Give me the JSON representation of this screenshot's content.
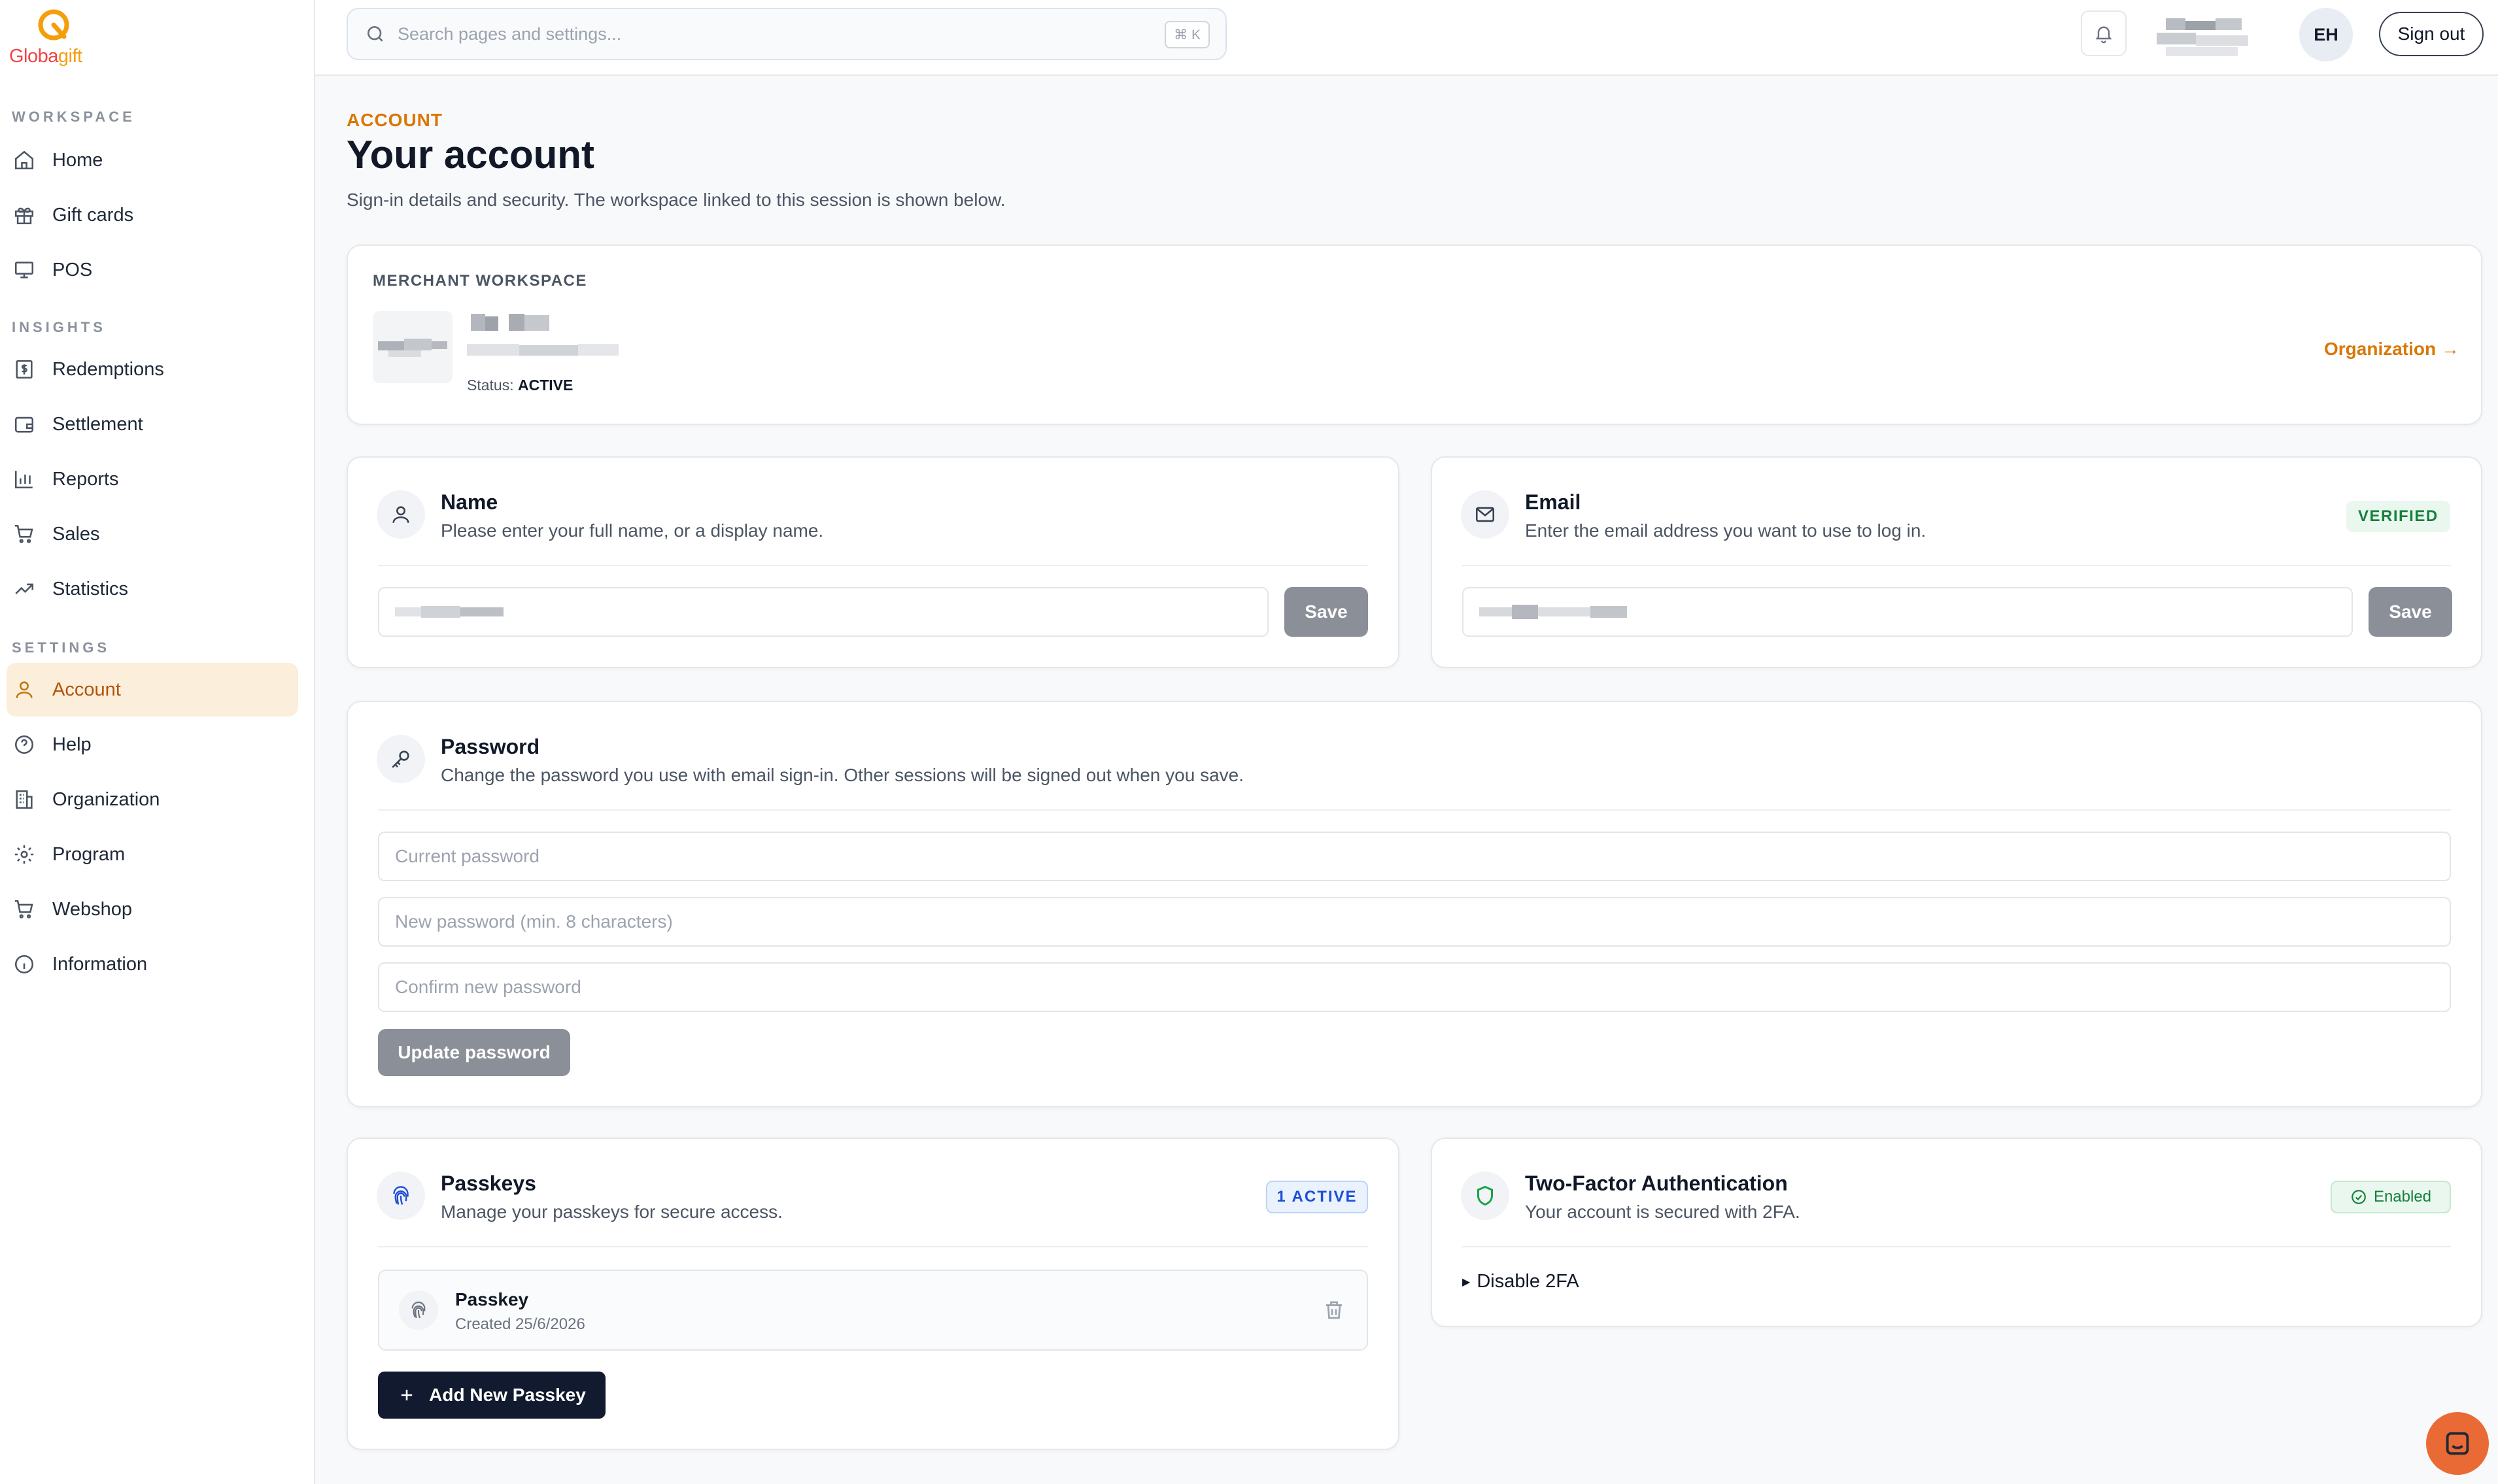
{
  "app": {
    "name_part1": "Globa",
    "name_part2": "gift",
    "brand_color": "#d97706"
  },
  "sidebar": {
    "sections": [
      {
        "title": "WORKSPACE",
        "items": [
          {
            "label": "Home",
            "icon": "home-icon"
          },
          {
            "label": "Gift cards",
            "icon": "gift-icon"
          },
          {
            "label": "POS",
            "icon": "monitor-icon"
          }
        ]
      },
      {
        "title": "INSIGHTS",
        "items": [
          {
            "label": "Redemptions",
            "icon": "receipt-icon"
          },
          {
            "label": "Settlement",
            "icon": "wallet-icon"
          },
          {
            "label": "Reports",
            "icon": "bar-chart-icon"
          },
          {
            "label": "Sales",
            "icon": "cart-icon"
          },
          {
            "label": "Statistics",
            "icon": "trend-icon"
          }
        ]
      },
      {
        "title": "SETTINGS",
        "items": [
          {
            "label": "Account",
            "icon": "user-icon",
            "active": true
          },
          {
            "label": "Help",
            "icon": "help-icon"
          },
          {
            "label": "Organization",
            "icon": "building-icon"
          },
          {
            "label": "Program",
            "icon": "gear-icon"
          },
          {
            "label": "Webshop",
            "icon": "cart-icon"
          },
          {
            "label": "Information",
            "icon": "info-icon"
          }
        ]
      }
    ]
  },
  "header": {
    "search_placeholder": "Search pages and settings...",
    "shortcut": "⌘ K",
    "avatar_initials": "EH",
    "sign_out": "Sign out"
  },
  "page": {
    "eyebrow": "ACCOUNT",
    "title": "Your account",
    "subtitle": "Sign-in details and security. The workspace linked to this session is shown below."
  },
  "merchant": {
    "label": "MERCHANT WORKSPACE",
    "status_label": "Status:",
    "status_value": "ACTIVE",
    "org_link": "Organization →"
  },
  "name_card": {
    "title": "Name",
    "description": "Please enter your full name, or a display name.",
    "save": "Save"
  },
  "email_card": {
    "title": "Email",
    "description": "Enter the email address you want to use to log in.",
    "badge": "VERIFIED",
    "save": "Save"
  },
  "password_card": {
    "title": "Password",
    "description": "Change the password you use with email sign-in. Other sessions will be signed out when you save.",
    "current_placeholder": "Current password",
    "new_placeholder": "New password (min. 8 characters)",
    "confirm_placeholder": "Confirm new password",
    "button": "Update password"
  },
  "passkeys_card": {
    "title": "Passkeys",
    "description": "Manage your passkeys for secure access.",
    "badge": "1 ACTIVE",
    "passkey_name": "Passkey",
    "passkey_created": "Created 25/6/2026",
    "add_button": "Add New Passkey"
  },
  "twofa_card": {
    "title": "Two-Factor Authentication",
    "description": "Your account is secured with 2FA.",
    "badge": "Enabled",
    "disable": "Disable 2FA"
  }
}
